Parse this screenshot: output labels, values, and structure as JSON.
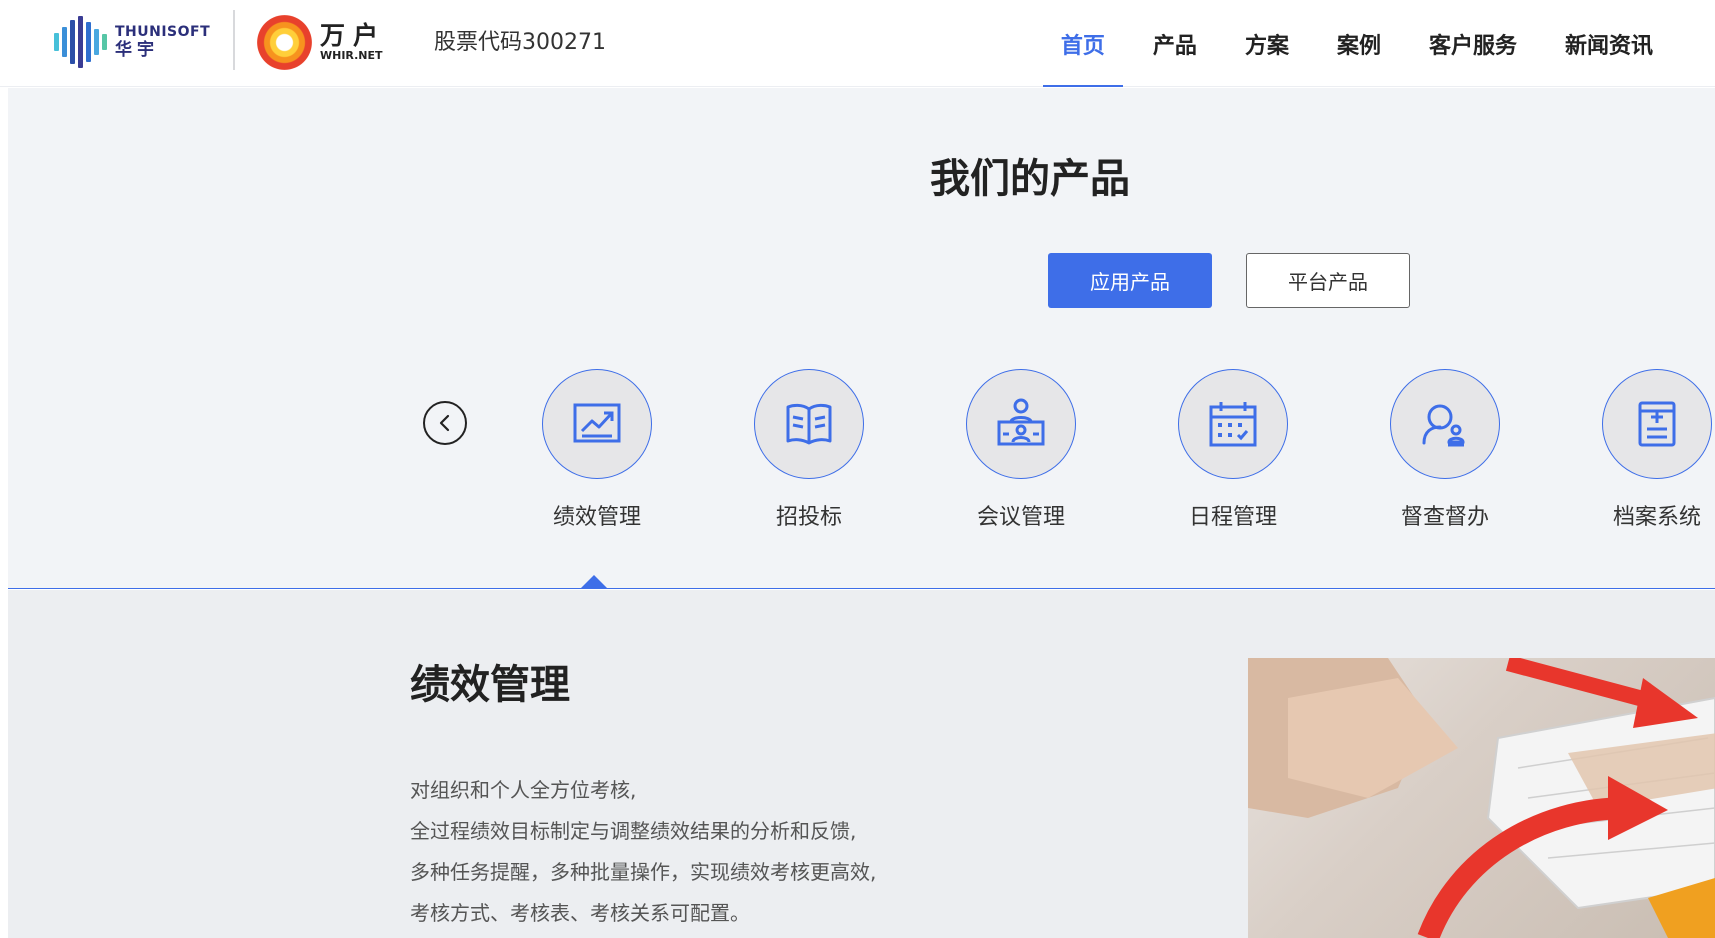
{
  "header": {
    "logo1": {
      "en": "THUNISOFT",
      "cn": "华宇"
    },
    "logo2": {
      "cn": "万户",
      "en": "WHIR.NET"
    },
    "stock": "股票代码300271",
    "nav": [
      {
        "label": "首页",
        "active": true
      },
      {
        "label": "产品",
        "active": false
      },
      {
        "label": "方案",
        "active": false
      },
      {
        "label": "案例",
        "active": false
      },
      {
        "label": "客户服务",
        "active": false
      },
      {
        "label": "新闻资讯",
        "active": false
      }
    ]
  },
  "products": {
    "title": "我们的产品",
    "tabs": [
      {
        "label": "应用产品",
        "active": true
      },
      {
        "label": "平台产品",
        "active": false
      }
    ],
    "items": [
      {
        "label": "绩效管理",
        "icon": "chart-icon"
      },
      {
        "label": "招投标",
        "icon": "book-icon"
      },
      {
        "label": "会议管理",
        "icon": "meeting-icon"
      },
      {
        "label": "日程管理",
        "icon": "calendar-icon"
      },
      {
        "label": "督查督办",
        "icon": "supervise-icon"
      },
      {
        "label": "档案系统",
        "icon": "archive-icon"
      }
    ],
    "selected_index": 0
  },
  "detail": {
    "title": "绩效管理",
    "lines": [
      "对组织和个人全方位考核,",
      "全过程绩效目标制定与调整绩效结果的分析和反馈,",
      "多种任务提醒，多种批量操作，实现绩效考核更高效,",
      "考核方式、考核表、考核关系可配置。"
    ]
  },
  "colors": {
    "accent": "#3e6ee8",
    "section_bg": "#f2f4f7",
    "detail_bg": "#eceef1"
  }
}
